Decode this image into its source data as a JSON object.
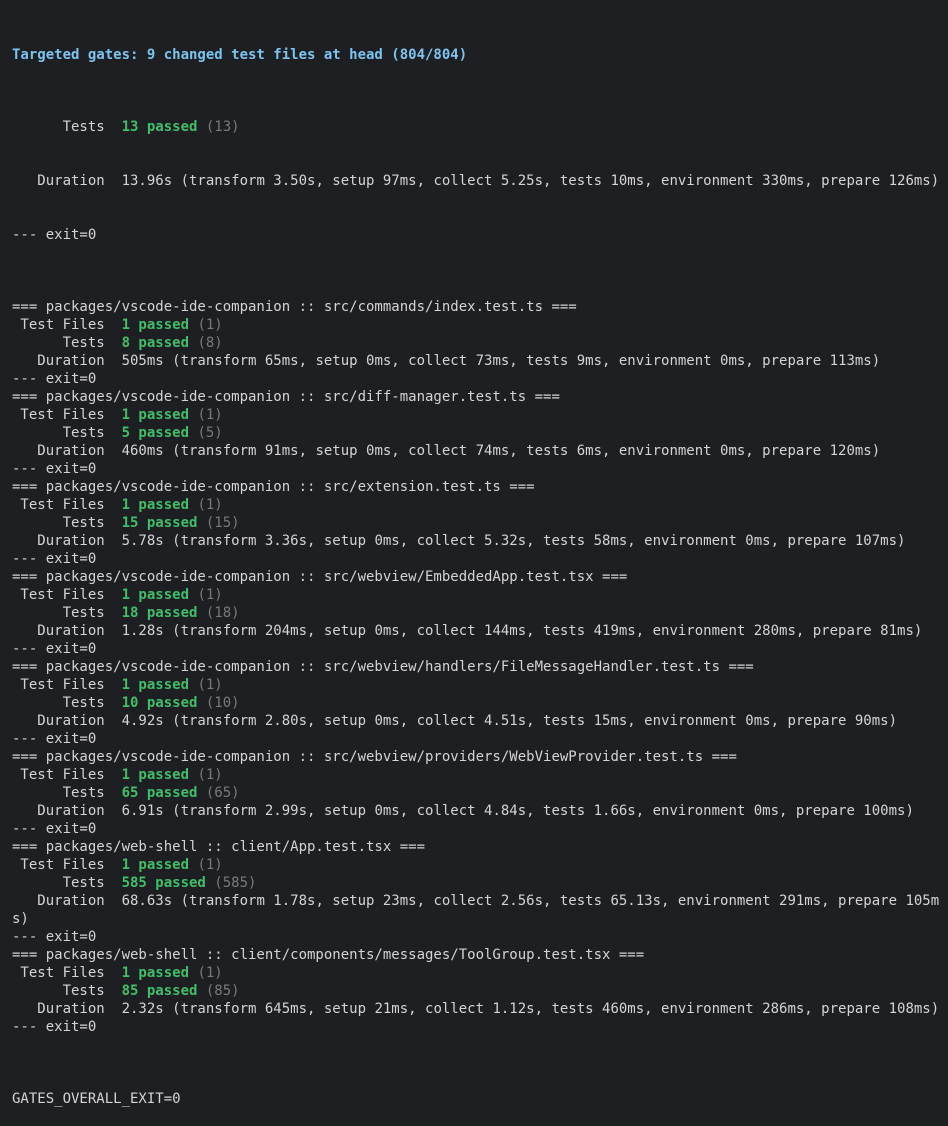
{
  "header": "Targeted gates: 9 changed test files at head (804/804)",
  "pre_lines": [
    {
      "label": "      Tests  ",
      "pass": "13 passed",
      "count": " (13)"
    },
    {
      "label": "   Duration  ",
      "text": "13.96s (transform 3.50s, setup 97ms, collect 5.25s, tests 10ms, environment 330ms, prepare 126ms)"
    },
    {
      "text": "--- exit=0"
    }
  ],
  "suites": [
    {
      "title": "=== packages/vscode-ide-companion :: src/commands/index.test.ts ===",
      "files_pass": "1 passed",
      "files_count": " (1)",
      "tests_pass": "8 passed",
      "tests_count": " (8)",
      "duration": "505ms (transform 65ms, setup 0ms, collect 73ms, tests 9ms, environment 0ms, prepare 113ms)",
      "exit": "--- exit=0"
    },
    {
      "title": "=== packages/vscode-ide-companion :: src/diff-manager.test.ts ===",
      "files_pass": "1 passed",
      "files_count": " (1)",
      "tests_pass": "5 passed",
      "tests_count": " (5)",
      "duration": "460ms (transform 91ms, setup 0ms, collect 74ms, tests 6ms, environment 0ms, prepare 120ms)",
      "exit": "--- exit=0"
    },
    {
      "title": "=== packages/vscode-ide-companion :: src/extension.test.ts ===",
      "files_pass": "1 passed",
      "files_count": " (1)",
      "tests_pass": "15 passed",
      "tests_count": " (15)",
      "duration": "5.78s (transform 3.36s, setup 0ms, collect 5.32s, tests 58ms, environment 0ms, prepare 107ms)",
      "exit": "--- exit=0"
    },
    {
      "title": "=== packages/vscode-ide-companion :: src/webview/EmbeddedApp.test.tsx ===",
      "files_pass": "1 passed",
      "files_count": " (1)",
      "tests_pass": "18 passed",
      "tests_count": " (18)",
      "duration": "1.28s (transform 204ms, setup 0ms, collect 144ms, tests 419ms, environment 280ms, prepare 81ms)",
      "exit": "--- exit=0"
    },
    {
      "title": "=== packages/vscode-ide-companion :: src/webview/handlers/FileMessageHandler.test.ts ===",
      "files_pass": "1 passed",
      "files_count": " (1)",
      "tests_pass": "10 passed",
      "tests_count": " (10)",
      "duration": "4.92s (transform 2.80s, setup 0ms, collect 4.51s, tests 15ms, environment 0ms, prepare 90ms)",
      "exit": "--- exit=0"
    },
    {
      "title": "=== packages/vscode-ide-companion :: src/webview/providers/WebViewProvider.test.ts ===",
      "files_pass": "1 passed",
      "files_count": " (1)",
      "tests_pass": "65 passed",
      "tests_count": " (65)",
      "duration": "6.91s (transform 2.99s, setup 0ms, collect 4.84s, tests 1.66s, environment 0ms, prepare 100ms)",
      "exit": "--- exit=0"
    },
    {
      "title": "=== packages/web-shell :: client/App.test.tsx ===",
      "files_pass": "1 passed",
      "files_count": " (1)",
      "tests_pass": "585 passed",
      "tests_count": " (585)",
      "duration": "68.63s (transform 1.78s, setup 23ms, collect 2.56s, tests 65.13s, environment 291ms, prepare 105m",
      "duration_wrap": "s)",
      "exit": "--- exit=0"
    },
    {
      "title": "=== packages/web-shell :: client/components/messages/ToolGroup.test.tsx ===",
      "files_pass": "1 passed",
      "files_count": " (1)",
      "tests_pass": "85 passed",
      "tests_count": " (85)",
      "duration": "2.32s (transform 645ms, setup 21ms, collect 1.12s, tests 460ms, environment 286ms, prepare 108ms)",
      "exit": "--- exit=0"
    }
  ],
  "labels": {
    "test_files": " Test Files  ",
    "tests": "      Tests  ",
    "duration": "   Duration  "
  },
  "footer": "GATES_OVERALL_EXIT=0",
  "colors": {
    "background": "#1e1f22",
    "text": "#d4d4d4",
    "header": "#7cc4f0",
    "pass": "#3fbf6a",
    "dim": "#7a7a7a"
  }
}
